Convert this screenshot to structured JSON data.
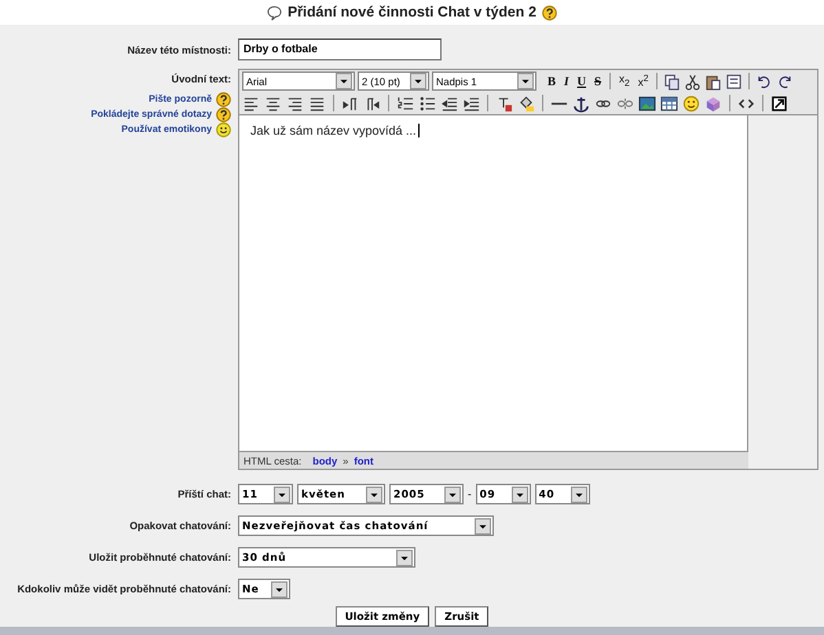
{
  "page_title": "Přidání nové činnosti Chat v týden 2",
  "name_field": {
    "label": "Název této místnosti:",
    "value": "Drby o fotbale"
  },
  "intro": {
    "label": "Úvodní text:",
    "help_links": [
      {
        "label": "Pište pozorně",
        "kind": "help"
      },
      {
        "label": "Pokládejte správné dotazy",
        "kind": "help"
      },
      {
        "label": "Používat emotikony",
        "kind": "emoticon"
      }
    ],
    "font_select": "Arial",
    "size_select": "2 (10 pt)",
    "format_select": "Nadpis 1",
    "format_buttons": [
      {
        "label": "B",
        "kind": "bold"
      },
      {
        "label": "I",
        "kind": "italic"
      },
      {
        "label": "U",
        "kind": "underline"
      },
      {
        "label": "S",
        "kind": "strike"
      }
    ],
    "script_buttons": [
      "x$_{2}$",
      "x$^{2}$"
    ],
    "content": "Jak už sám název vypovídá ...",
    "path_label": "HTML cesta:",
    "path": [
      "body",
      "font"
    ],
    "path_separator": "»"
  },
  "next_chat": {
    "label": "Příští chat:",
    "day": "11",
    "month": "květen",
    "year": "2005",
    "dash": "-",
    "hour": "09",
    "minute": "40"
  },
  "repeat": {
    "label": "Opakovat chatování:",
    "value": "Nezveřejňovat čas chatování"
  },
  "keep": {
    "label": "Uložit proběhnuté chatování:",
    "value": "30 dnů"
  },
  "student_logs": {
    "label": "Kdokoliv může vidět proběhnuté chatování:",
    "value": "Ne"
  },
  "buttons": [
    "Uložit změny",
    "Zrušit"
  ]
}
